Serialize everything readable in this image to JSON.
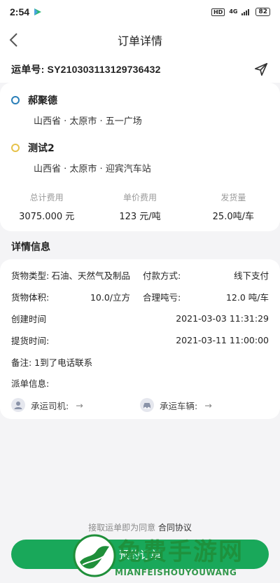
{
  "status_bar": {
    "time": "2:54",
    "hd": "HD",
    "network": "4G",
    "battery": "82"
  },
  "nav": {
    "title": "订单详情"
  },
  "order": {
    "label": "运单号: SY210303113129736432"
  },
  "route": {
    "origin_name": "郝聚德",
    "origin_address": "山西省 · 太原市 · 五一广场",
    "destination_name": "测试2",
    "destination_address": "山西省 · 太原市 · 迎宾汽车站"
  },
  "fees": [
    {
      "label": "总计费用",
      "value": "3075.000 元"
    },
    {
      "label": "单价费用",
      "value": "123 元/吨"
    },
    {
      "label": "发货量",
      "value": "25.0吨/车"
    }
  ],
  "details": {
    "section_title": "详情信息",
    "cargo_type_label": "货物类型:",
    "cargo_type_value": "石油、天然气及制品",
    "payment_label": "付款方式:",
    "payment_value": "线下支付",
    "volume_label": "货物体积:",
    "volume_value": "10.0/立方",
    "loss_label": "合理吨亏:",
    "loss_value": "12.0 吨/车",
    "created_label": "创建时间",
    "created_value": "2021-03-03 11:31:29",
    "pickup_label": "提货时间:",
    "pickup_value": "2021-03-11 11:00:00",
    "remark": "备注: 1到了电话联系",
    "dispatch_label": "派单信息:",
    "driver_label": "承运司机:",
    "vehicle_label": "承运车辆:",
    "arrow": "→"
  },
  "footer": {
    "agree_prefix": "接取运单即为同意",
    "agree_link": "合同协议",
    "button_label": "预约订单"
  },
  "watermark": {
    "title": "免费手游网",
    "subtitle": "MIANFEISHOUYOUWANG"
  },
  "colors": {
    "accent_green": "#19a85a",
    "origin_dot": "#2a7fb8",
    "destination_dot": "#e6c24a"
  },
  "icons": [
    "play-store-icon",
    "back-icon",
    "send-icon",
    "driver-avatar-icon",
    "car-icon"
  ]
}
